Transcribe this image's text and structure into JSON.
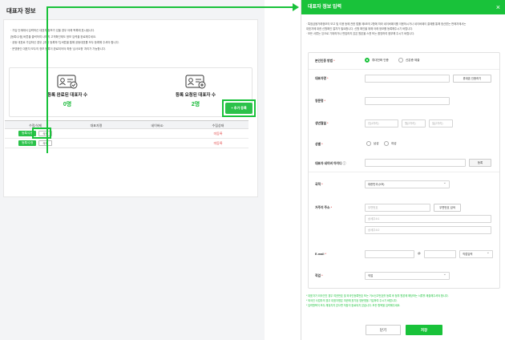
{
  "left": {
    "title": "대표자 정보",
    "notes": [
      "· 가입 단계에서 입력하신 대표자 정보가 있을 경우 아래 목록에 표시됩니다.",
      "   [등록/수정] 버튼을 클릭하여 나머지 고객확인제도 정보 입력을 완료해주세요.",
      "· 공동 대표로 가입하신 경우, [추가 등록하기] 버튼을 통해 공동대표를 모두 등록해 주셔야 합니다.",
      "· 운영중인 대표자 모두의 정보 등록이 완료되어야 최종 '심사요청' 처리가 가능합니다."
    ],
    "stats": [
      {
        "label": "등록 완료된 대표자 수",
        "value": "0명"
      },
      {
        "label": "등록 요청된 대표자 수",
        "value": "2명"
      }
    ],
    "add_button": "+ 추가 등록",
    "table": {
      "headers": [
        "수정/삭제",
        "대표자명",
        "네이버ID",
        "수집상태"
      ],
      "rows": [
        {
          "edit": "등록/수정",
          "delete": "삭제",
          "name": "",
          "naver_id": "",
          "status": "미등록"
        },
        {
          "edit": "등록/수정",
          "delete": "삭제",
          "name": "",
          "naver_id": "",
          "status": "미등록"
        }
      ]
    }
  },
  "dialog": {
    "title": "대표자 정보 입력",
    "close_icon": "×",
    "notes": [
      "· 특정금융거래정보의 보고 및 이용 등에 관한 법률 제5조의 2항에 따라 네이버페이를 이용하시거나 네이버페이 결제를 통해 정산받는 판매자께서는",
      "  대표자에 대한 신원확인 절차가 필요합니다. 신원 확인을 위해 아래 정보를 등록해주시기 바랍니다.",
      "· 모든 서류는 잉크로 기재하거나 편집하지 않은 원본을 스캔 또는 촬영하여 첨부해 주시기 바랍니다."
    ],
    "fields": {
      "auth_label": "본인인증 방법",
      "auth_opt1": "휴대전화 인증",
      "auth_opt2": "신분증 제출",
      "name_label": "대표자명",
      "name_btn": "휴대폰 인증하기",
      "eng_label": "영문명",
      "birth_label": "생년월일",
      "birth_y": "년(4자리)",
      "birth_m": "월(2자리)",
      "birth_d": "일(2자리)",
      "gender_label": "성별",
      "gender_m": "남성",
      "gender_f": "여성",
      "naver_label": "대표자 네이버 아이디",
      "naver_btn": "등록",
      "nation_label": "국적",
      "nation_value": "대한민국 (KR)",
      "addr_label": "거주지 주소",
      "zip_placeholder": "우편번호",
      "zip_btn": "우편번호 검색",
      "addr1_placeholder": "상세주소1",
      "addr2_placeholder": "상세주소2",
      "email_label": "E-mail",
      "email_at": "@",
      "email_domain": "직접입력",
      "job_label": "직업",
      "job_value": "직업"
    },
    "footer_notes": [
      "* 대표자가 외국인인 경우 여권번호 및 외국인등록번호 또는 거소신고번호를 등록 후 첨부 원본에 해당하는 서류를 제출해주셔야 합니다.",
      "* 외국인 사업자의 경우 대표자명은 여권에 표기된 영문명을 기입하여 주시기 바랍니다.",
      "* 입력항목이 모두 채워지지 않으면 저장이 완료되지 않습니다. 모든 항목을 입력해주세요."
    ],
    "btn_close": "닫기",
    "btn_save": "저장"
  },
  "colors": {
    "accent": "#19c23a",
    "alert": "#e24848"
  }
}
